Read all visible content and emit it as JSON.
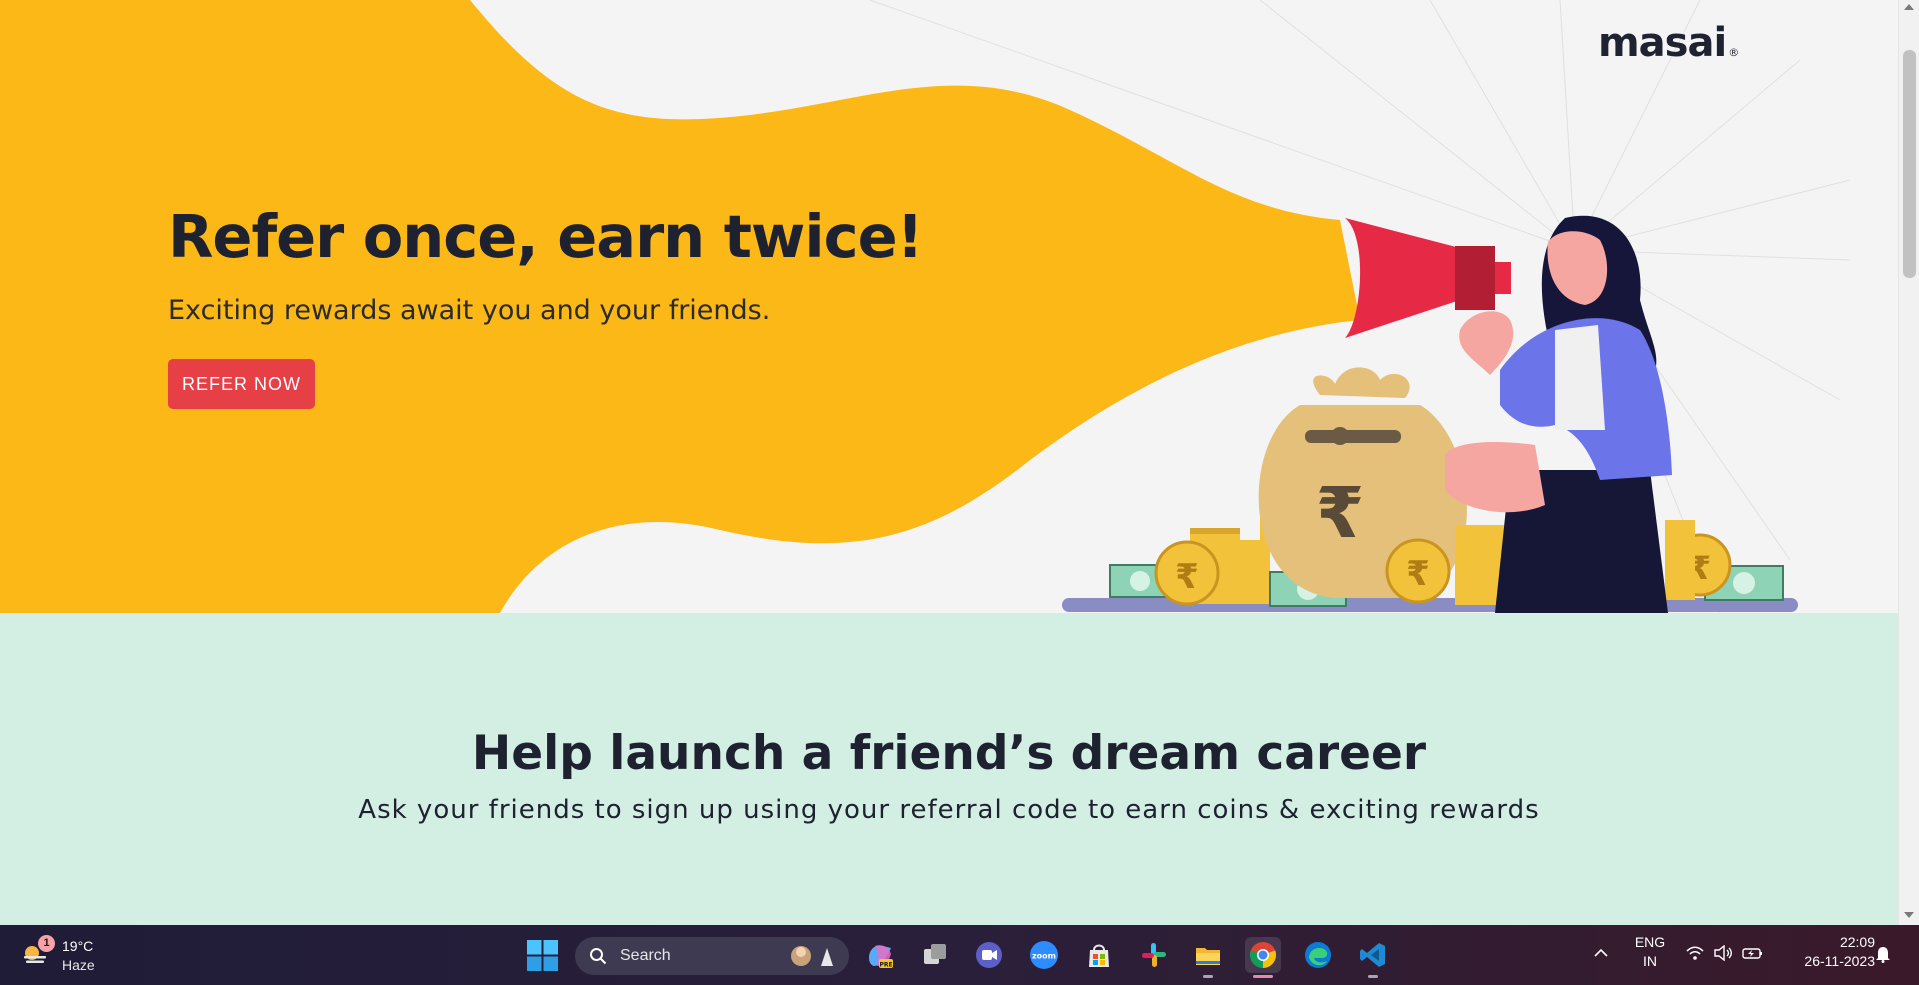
{
  "brand": {
    "logo_text": "masai",
    "logo_mark": "®"
  },
  "hero": {
    "title": "Refer once, earn twice!",
    "subtitle": "Exciting rewards await you and your friends.",
    "cta_label": "REFER NOW",
    "currency_symbol": "₹"
  },
  "help": {
    "title": "Help launch a friend’s dream career",
    "subtitle": "Ask your friends to sign up using your referral code to earn coins & exciting rewards"
  },
  "colors": {
    "hero_yellow": "#fbb817",
    "cta_red": "#e63f46",
    "megaphone_red": "#e62a46",
    "help_bg": "#d3eee2",
    "text_dark": "#1e2230",
    "jacket_blue": "#6b74e8",
    "coin_gold": "#f2c23a",
    "note_green": "#8fd3b6"
  },
  "taskbar": {
    "weather": {
      "badge": "1",
      "temperature": "19°C",
      "condition": "Haze",
      "icon": "weather-haze-icon"
    },
    "search_placeholder": "Search",
    "apps": [
      {
        "name": "windows-start",
        "icon": "windows-logo-icon"
      },
      {
        "name": "copilot",
        "icon": "copilot-icon"
      },
      {
        "name": "task-view",
        "icon": "task-view-icon"
      },
      {
        "name": "teams-meet",
        "icon": "video-chat-icon"
      },
      {
        "name": "zoom",
        "icon": "zoom-icon",
        "label": "zoom"
      },
      {
        "name": "microsoft-store",
        "icon": "store-icon"
      },
      {
        "name": "slack",
        "icon": "slack-icon"
      },
      {
        "name": "file-explorer",
        "icon": "folder-icon"
      },
      {
        "name": "chrome",
        "icon": "chrome-icon"
      },
      {
        "name": "edge",
        "icon": "edge-icon"
      },
      {
        "name": "vscode",
        "icon": "vscode-icon"
      }
    ],
    "language": {
      "line1": "ENG",
      "line2": "IN"
    },
    "clock": {
      "time": "22:09",
      "date": "26-11-2023"
    }
  }
}
